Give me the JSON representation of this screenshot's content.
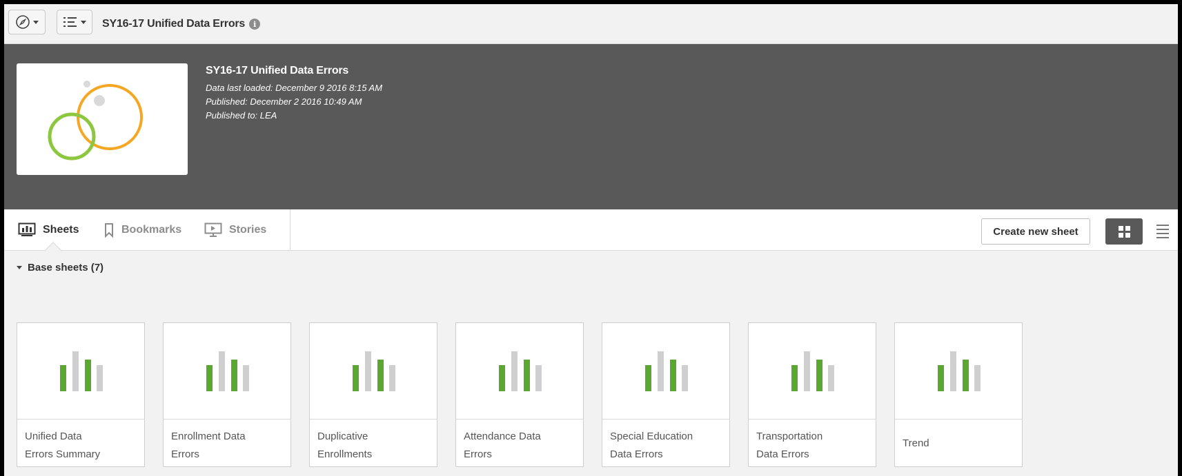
{
  "toolbar": {
    "app_title": "SY16-17 Unified Data Errors",
    "nav_icon": "compass-icon",
    "list_icon": "list-icon"
  },
  "header": {
    "title": "SY16-17 Unified Data Errors",
    "data_last_loaded": "Data last loaded: December 9 2016 8:15 AM",
    "published": "Published: December 2 2016 10:49 AM",
    "published_to": "Published to: LEA"
  },
  "tabs": [
    {
      "label": "Sheets",
      "active": true
    },
    {
      "label": "Bookmarks",
      "active": false
    },
    {
      "label": "Stories",
      "active": false
    }
  ],
  "actions": {
    "create_new_sheet": "Create new sheet"
  },
  "section": {
    "title": "Base sheets (7)"
  },
  "colors": {
    "banner": "#595959",
    "bar_green": "#5aa832",
    "bar_gray": "#cfcfcf",
    "thumb_orange": "#f5a623",
    "thumb_green": "#8dc63f"
  },
  "sheets": [
    {
      "line1": "Unified Data",
      "line2": "Errors Summary"
    },
    {
      "line1": "Enrollment Data",
      "line2": "Errors"
    },
    {
      "line1": "Duplicative",
      "line2": "Enrollments"
    },
    {
      "line1": "Attendance Data",
      "line2": "Errors"
    },
    {
      "line1": "Special Education",
      "line2": "Data Errors"
    },
    {
      "line1": "Transportation",
      "line2": "Data Errors"
    },
    {
      "line1": "Trend",
      "line2": ""
    }
  ]
}
